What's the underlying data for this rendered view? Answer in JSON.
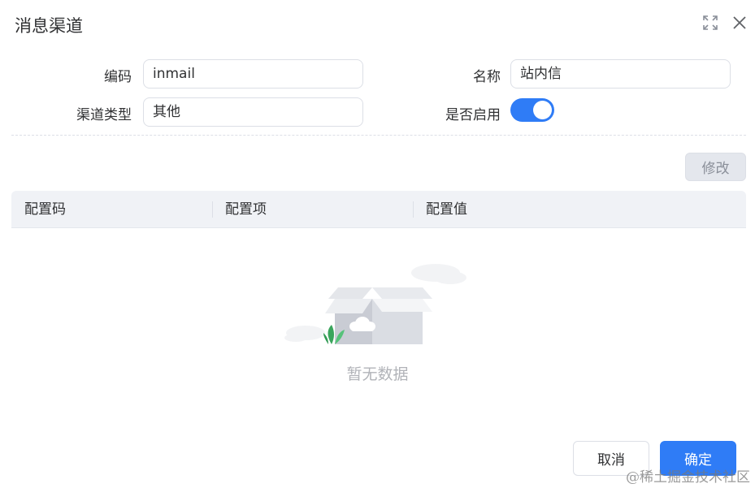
{
  "dialog": {
    "title": "消息渠道"
  },
  "form": {
    "code": {
      "label": "编码",
      "value": "inmail"
    },
    "name": {
      "label": "名称",
      "value": "站内信"
    },
    "channel_type": {
      "label": "渠道类型",
      "value": "其他"
    },
    "enabled": {
      "label": "是否启用",
      "on": true
    }
  },
  "toolbar": {
    "edit_label": "修改"
  },
  "table": {
    "columns": [
      "配置码",
      "配置项",
      "配置值"
    ],
    "rows": [],
    "empty_text": "暂无数据"
  },
  "footer": {
    "cancel_label": "取消",
    "confirm_label": "确定"
  },
  "watermark": "@稀土掘金技术社区",
  "colors": {
    "primary": "#2f7cf6",
    "border": "#dcdfe6",
    "header_bg": "#f0f2f6"
  },
  "icons": {
    "fullscreen": "fullscreen-icon",
    "close": "close-icon"
  }
}
